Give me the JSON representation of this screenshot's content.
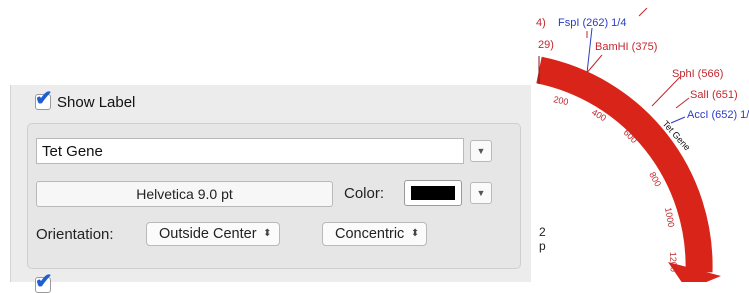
{
  "panel": {
    "show_label": {
      "label": "Show Label",
      "checked": true
    },
    "label_text": "Tet Gene",
    "font_button": "Helvetica 9.0 pt",
    "color_label": "Color:",
    "color_value": "#000000",
    "orientation_label": "Orientation:",
    "orientation_value": "Outside Center",
    "style_value": "Concentric"
  },
  "map": {
    "enzymes": [
      {
        "text": "4)",
        "color": "#c0282f"
      },
      {
        "text": "FspI (262) 1/4",
        "color": "#2a3cc7"
      },
      {
        "text": "29)",
        "color": "#c0282f"
      },
      {
        "text": "BamHI (375)",
        "color": "#c0282f"
      },
      {
        "text": "SphI (566)",
        "color": "#c0282f"
      },
      {
        "text": "SalI (651)",
        "color": "#c0282f"
      },
      {
        "text": "AccI (652) 1/2",
        "color": "#2a3cc7"
      }
    ],
    "ticks": [
      "200",
      "400",
      "600",
      "800",
      "1000",
      "1200"
    ],
    "feature_label": "Tet Gene",
    "fragment_line1": "2",
    "fragment_line2": "p",
    "arc_color": "#d9241a"
  }
}
